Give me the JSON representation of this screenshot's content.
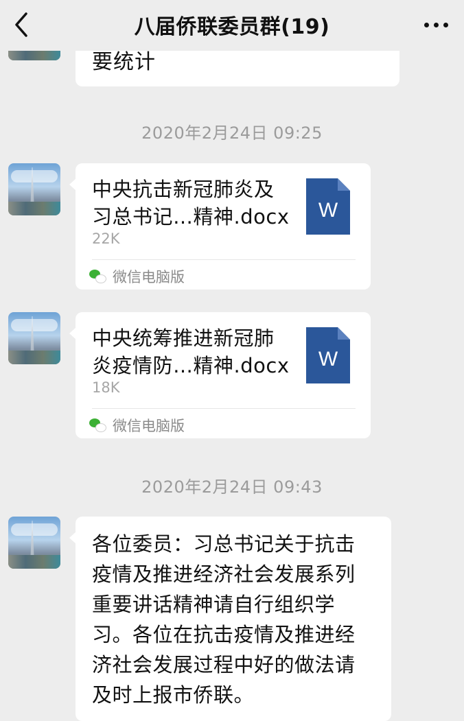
{
  "header": {
    "title": "八届侨联委员群(19)",
    "back_icon": "chevron-left-icon",
    "more_icon": "ellipsis-icon"
  },
  "messages": [
    {
      "type": "text",
      "text": "要统计"
    },
    {
      "type": "time",
      "text": "2020年2月24日 09:25"
    },
    {
      "type": "file",
      "name_line1": "中央抗击新冠肺炎及",
      "name_line2": "习总书记…精神.docx",
      "size": "22K",
      "source": "微信电脑版",
      "icon": "word-doc-icon",
      "icon_letter": "W"
    },
    {
      "type": "file",
      "name_line1": "中央统筹推进新冠肺",
      "name_line2": "炎疫情防…精神.docx",
      "size": "18K",
      "source": "微信电脑版",
      "icon": "word-doc-icon",
      "icon_letter": "W"
    },
    {
      "type": "time",
      "text": "2020年2月24日 09:43"
    },
    {
      "type": "text",
      "lines": [
        "各位委员：习总书记关于抗击",
        "疫情及推进经济社会发展系列",
        "重要讲话精神请自行组织学",
        "习。各位在抗击疫情及推进经",
        "济社会发展过程中好的做法请",
        "及时上报市侨联。"
      ]
    }
  ],
  "colors": {
    "background": "#ededed",
    "bubble": "#ffffff",
    "timestamp": "#9b9b9b",
    "word_blue": "#2b579a",
    "wechat_green": "#3cb035"
  }
}
